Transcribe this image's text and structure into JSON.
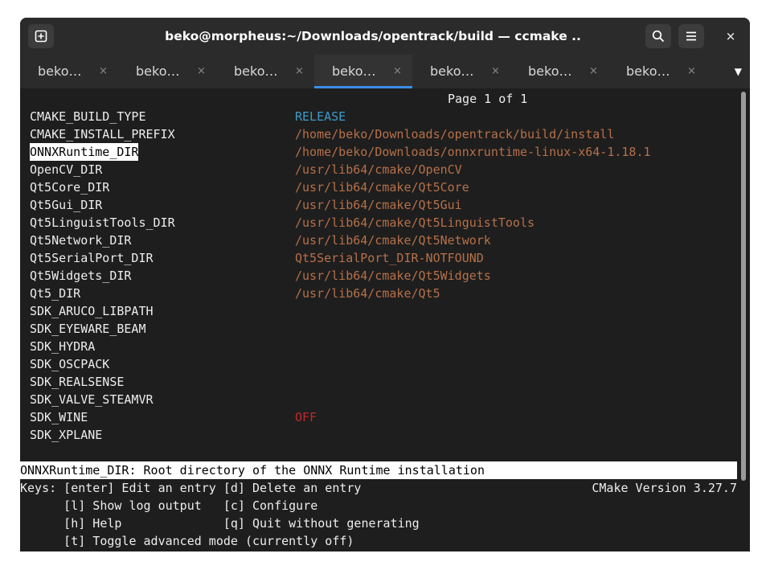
{
  "window": {
    "title": "beko@morpheus:~/Downloads/opentrack/build — ccmake ..",
    "close_glyph": "×"
  },
  "tabs": [
    {
      "label": "beko…",
      "close": "×",
      "active": false
    },
    {
      "label": "beko…",
      "close": "×",
      "active": false
    },
    {
      "label": "beko…",
      "close": "×",
      "active": false
    },
    {
      "label": "beko…",
      "close": "×",
      "active": true
    },
    {
      "label": "beko…",
      "close": "×",
      "active": false
    },
    {
      "label": "beko…",
      "close": "×",
      "active": false
    },
    {
      "label": "beko…",
      "close": "×",
      "active": false
    }
  ],
  "tab_menu_glyph": "▼",
  "ccmake": {
    "page_info": "Page 1 of 1",
    "entries": [
      {
        "key": "CMAKE_BUILD_TYPE",
        "value": "RELEASE",
        "kind": "release",
        "selected": false
      },
      {
        "key": "CMAKE_INSTALL_PREFIX",
        "value": "/home/beko/Downloads/opentrack/build/install",
        "kind": "path",
        "selected": false
      },
      {
        "key": "ONNXRuntime_DIR",
        "value": "/home/beko/Downloads/onnxruntime-linux-x64-1.18.1",
        "kind": "path",
        "selected": true
      },
      {
        "key": "OpenCV_DIR",
        "value": "/usr/lib64/cmake/OpenCV",
        "kind": "path",
        "selected": false
      },
      {
        "key": "Qt5Core_DIR",
        "value": "/usr/lib64/cmake/Qt5Core",
        "kind": "path",
        "selected": false
      },
      {
        "key": "Qt5Gui_DIR",
        "value": "/usr/lib64/cmake/Qt5Gui",
        "kind": "path",
        "selected": false
      },
      {
        "key": "Qt5LinguistTools_DIR",
        "value": "/usr/lib64/cmake/Qt5LinguistTools",
        "kind": "path",
        "selected": false
      },
      {
        "key": "Qt5Network_DIR",
        "value": "/usr/lib64/cmake/Qt5Network",
        "kind": "path",
        "selected": false
      },
      {
        "key": "Qt5SerialPort_DIR",
        "value": "Qt5SerialPort_DIR-NOTFOUND",
        "kind": "path",
        "selected": false
      },
      {
        "key": "Qt5Widgets_DIR",
        "value": "/usr/lib64/cmake/Qt5Widgets",
        "kind": "path",
        "selected": false
      },
      {
        "key": "Qt5_DIR",
        "value": "/usr/lib64/cmake/Qt5",
        "kind": "path",
        "selected": false
      },
      {
        "key": "SDK_ARUCO_LIBPATH",
        "value": "",
        "kind": "path",
        "selected": false
      },
      {
        "key": "SDK_EYEWARE_BEAM",
        "value": "",
        "kind": "path",
        "selected": false
      },
      {
        "key": "SDK_HYDRA",
        "value": "",
        "kind": "path",
        "selected": false
      },
      {
        "key": "SDK_OSCPACK",
        "value": "",
        "kind": "path",
        "selected": false
      },
      {
        "key": "SDK_REALSENSE",
        "value": "",
        "kind": "path",
        "selected": false
      },
      {
        "key": "SDK_VALVE_STEAMVR",
        "value": "",
        "kind": "path",
        "selected": false
      },
      {
        "key": "SDK_WINE",
        "value": "OFF",
        "kind": "off",
        "selected": false
      },
      {
        "key": "SDK_XPLANE",
        "value": "",
        "kind": "path",
        "selected": false
      }
    ],
    "help_line": "ONNXRuntime_DIR: Root directory of the ONNX Runtime installation",
    "keys_lines": [
      "Keys: [enter] Edit an entry [d] Delete an entry",
      "      [l] Show log output   [c] Configure",
      "      [h] Help              [q] Quit without generating",
      "      [t] Toggle advanced mode (currently off)"
    ],
    "version": "CMake Version 3.27.7"
  },
  "colors": {
    "path_value": "#b5704a",
    "release_value": "#3d9bc7",
    "off_value": "#c0282e",
    "active_tab_indicator": "#3a8ee6"
  }
}
